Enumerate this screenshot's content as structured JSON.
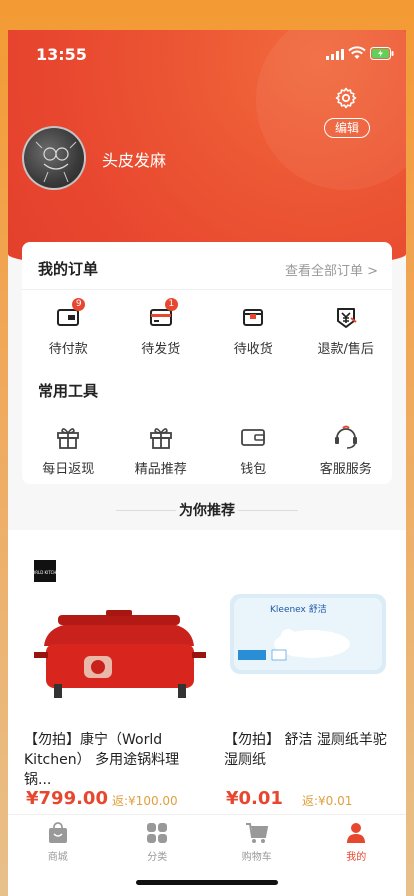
{
  "status_bar": {
    "time": "13:55"
  },
  "profile": {
    "username": "头皮发麻",
    "edit_label": "编辑"
  },
  "orders": {
    "title": "我的订单",
    "view_all": "查看全部订单 >",
    "items": [
      {
        "label": "待付款",
        "icon": "wallet-icon",
        "badge": "9"
      },
      {
        "label": "待发货",
        "icon": "card-icon",
        "badge": "1"
      },
      {
        "label": "待收货",
        "icon": "box-icon",
        "badge": ""
      },
      {
        "label": "退款/售后",
        "icon": "refund-icon",
        "badge": ""
      }
    ]
  },
  "tools": {
    "title": "常用工具",
    "items": [
      {
        "label": "每日返现",
        "icon": "gift-icon"
      },
      {
        "label": "精品推荐",
        "icon": "gift-icon"
      },
      {
        "label": "钱包",
        "icon": "wallet-icon"
      },
      {
        "label": "客服服务",
        "icon": "headset-icon"
      }
    ]
  },
  "recommend": {
    "title": "为你推荐",
    "products": [
      {
        "name": "【勿拍】康宁（World Kitchen） 多用途锅料理锅...",
        "price": "¥799.00",
        "rebate": "返:¥100.00",
        "image_text": "WORLD KITCHEN"
      },
      {
        "name": "【勿拍】 舒洁 湿厕纸羊驼湿厕纸",
        "price": "¥0.01",
        "rebate": "返:¥0.01",
        "image_text": "Kleenex 舒洁"
      }
    ]
  },
  "tabbar": [
    {
      "label": "商城",
      "icon": "shop-bag-icon",
      "active": false
    },
    {
      "label": "分类",
      "icon": "grid-icon",
      "active": false
    },
    {
      "label": "购物车",
      "icon": "cart-icon",
      "active": false
    },
    {
      "label": "我的",
      "icon": "user-icon",
      "active": true
    }
  ],
  "colors": {
    "accent": "#e8472f",
    "rebate": "#e0a040"
  }
}
